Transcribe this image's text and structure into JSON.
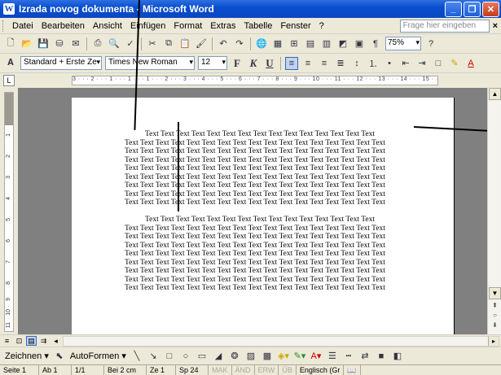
{
  "window": {
    "title": "Izrada novog dokumenta - Microsoft Word",
    "app_icon_letter": "W",
    "minimize": "_",
    "maximize": "❐",
    "close": "✕"
  },
  "menubar": {
    "items": [
      {
        "label": "Datei"
      },
      {
        "label": "Bearbeiten"
      },
      {
        "label": "Ansicht"
      },
      {
        "label": "Einfügen"
      },
      {
        "label": "Format"
      },
      {
        "label": "Extras"
      },
      {
        "label": "Tabelle"
      },
      {
        "label": "Fenster"
      },
      {
        "label": "?"
      }
    ],
    "help_placeholder": "Frage hier eingeben",
    "close_doc": "×"
  },
  "standard_toolbar": {
    "zoom": "75%",
    "help_glyph": "?"
  },
  "format_toolbar": {
    "style": "Standard + Erste Ze",
    "font": "Times New Roman",
    "size": "12",
    "bold": "F",
    "italic": "K",
    "underline": "U"
  },
  "ruler": {
    "corner": "L",
    "scale": "3 · · · 2 · · · 1 · · · 1 · · · 1 · · · 2 · · · 3 · · · 4 · · · 5 · · · 6 · · · 7 · · · 8 · · · 9 · · · 10 · · · 11 · · · 12 · · · 13 · · · 14 · · · 15 · · · 17 · · ·",
    "vertical_numbers": [
      "1",
      "2",
      "3",
      "4",
      "5",
      "6",
      "7",
      "8",
      "9",
      "10",
      "11"
    ]
  },
  "document": {
    "paragraph1": [
      "Text Text Text Text Text Text Text Text Text Text Text Text Text Text Text",
      "Text Text Text Text Text Text Text Text Text Text Text Text Text Text Text Text Text",
      "Text Text Text Text Text Text Text Text Text Text Text Text Text Text Text Text Text",
      "Text Text Text Text Text Text Text Text Text Text Text Text Text Text Text Text Text",
      "Text Text Text Text Text Text Text Text Text Text Text Text Text Text Text Text Text",
      "Text Text Text Text Text Text Text Text Text Text Text Text Text Text Text Text Text",
      "Text Text Text Text Text Text Text Text Text Text Text Text Text Text Text Text Text",
      "Text Text Text Text Text Text Text Text Text Text Text Text Text Text Text Text Text",
      "Text Text Text Text Text Text Text Text Text Text Text Text Text Text Text Text Text"
    ],
    "paragraph2": [
      "Text Text Text Text Text Text Text Text Text Text Text Text Text Text Text",
      "Text Text Text Text Text Text Text Text Text Text Text Text Text Text Text Text Text",
      "Text Text Text Text Text Text Text Text Text Text Text Text Text Text Text Text Text",
      "Text Text Text Text Text Text Text Text Text Text Text Text Text Text Text Text Text",
      "Text Text Text Text Text Text Text Text Text Text Text Text Text Text Text Text Text",
      "Text Text Text Text Text Text Text Text Text Text Text Text Text Text Text Text Text",
      "Text Text Text Text Text Text Text Text Text Text Text Text Text Text Text Text Text",
      "Text Text Text Text Text Text Text Text Text Text Text Text Text Text Text Text Text",
      "Text Text Text Text Text Text Text Text Text Text Text Text Text Text Text Text Text"
    ]
  },
  "drawing_toolbar": {
    "draw_label": "Zeichnen",
    "autoshapes_label": "AutoFormen"
  },
  "statusbar": {
    "page": "Seite 1",
    "section": "Ab 1",
    "pages": "1/1",
    "position": "Bei 2 cm",
    "line": "Ze 1",
    "column": "Sp 24",
    "mak": "MAK",
    "and": "ÄND",
    "erw": "ERW",
    "ub": "ÜB",
    "language": "Englisch (Gr"
  },
  "colors": {
    "titlebar": "#0b47c0",
    "chrome": "#ece9d8",
    "canvas": "#808080"
  }
}
